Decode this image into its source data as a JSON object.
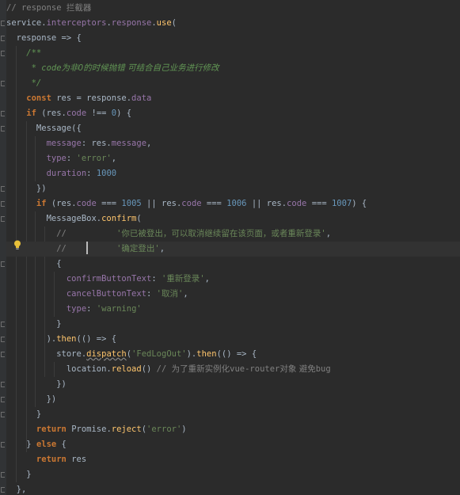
{
  "lines": [
    [
      [
        "cm-plain",
        "// response "
      ],
      [
        "cm-plain cn",
        "拦截器"
      ]
    ],
    [
      [
        "plain",
        "service."
      ],
      [
        "prop",
        "interceptors"
      ],
      [
        "plain",
        "."
      ],
      [
        "prop",
        "response"
      ],
      [
        "plain",
        "."
      ],
      [
        "fn",
        "use"
      ],
      [
        "plain",
        "("
      ]
    ],
    [
      [
        "plain",
        "  response => {"
      ]
    ],
    [
      [
        "doc",
        "    /**"
      ]
    ],
    [
      [
        "doc",
        "     * code"
      ],
      [
        "doc cn",
        "为非0的时候抛错 可结合自己业务进行修改"
      ]
    ],
    [
      [
        "doc",
        "     */"
      ]
    ],
    [
      [
        "kw",
        "    const "
      ],
      [
        "plain",
        "res = response."
      ],
      [
        "prop",
        "data"
      ]
    ],
    [
      [
        "kw",
        "    if "
      ],
      [
        "plain",
        "(res."
      ],
      [
        "prop",
        "code"
      ],
      [
        "plain",
        " !== "
      ],
      [
        "num",
        "0"
      ],
      [
        "plain",
        ") {"
      ]
    ],
    [
      [
        "plain",
        "      Message({"
      ]
    ],
    [
      [
        "prop",
        "        message"
      ],
      [
        "plain",
        ": res."
      ],
      [
        "prop",
        "message"
      ],
      [
        "plain",
        ","
      ]
    ],
    [
      [
        "prop",
        "        type"
      ],
      [
        "plain",
        ": "
      ],
      [
        "str",
        "'error'"
      ],
      [
        "plain",
        ","
      ]
    ],
    [
      [
        "prop",
        "        duration"
      ],
      [
        "plain",
        ": "
      ],
      [
        "num",
        "1000"
      ]
    ],
    [
      [
        "plain",
        "      })"
      ]
    ],
    [
      [
        "kw",
        "      if "
      ],
      [
        "plain",
        "(res."
      ],
      [
        "prop",
        "code"
      ],
      [
        "plain",
        " === "
      ],
      [
        "num",
        "1005"
      ],
      [
        "plain",
        " || res."
      ],
      [
        "prop",
        "code"
      ],
      [
        "plain",
        " === "
      ],
      [
        "num",
        "1006"
      ],
      [
        "plain",
        " || res."
      ],
      [
        "prop",
        "code"
      ],
      [
        "plain",
        " === "
      ],
      [
        "num",
        "1007"
      ],
      [
        "plain",
        ") {"
      ]
    ],
    [
      [
        "plain",
        "        MessageBox."
      ],
      [
        "fn",
        "confirm"
      ],
      [
        "plain",
        "("
      ]
    ],
    [
      [
        "cm-plain",
        "          //          "
      ],
      [
        "str",
        "'"
      ],
      [
        "str cn",
        "你已被登出，可以取消继续留在该页面，或者重新登录"
      ],
      [
        "str",
        "'"
      ],
      [
        "plain",
        ","
      ]
    ],
    [
      [
        "cm-plain",
        "          //          "
      ],
      [
        "str",
        "'"
      ],
      [
        "str cn",
        "确定登出"
      ],
      [
        "str",
        "'"
      ],
      [
        "plain",
        ","
      ]
    ],
    [
      [
        "plain",
        "          {"
      ]
    ],
    [
      [
        "prop",
        "            confirmButtonText"
      ],
      [
        "plain",
        ": "
      ],
      [
        "str",
        "'"
      ],
      [
        "str cn",
        "重新登录"
      ],
      [
        "str",
        "'"
      ],
      [
        "plain",
        ","
      ]
    ],
    [
      [
        "prop",
        "            cancelButtonText"
      ],
      [
        "plain",
        ": "
      ],
      [
        "str",
        "'"
      ],
      [
        "str cn",
        "取消"
      ],
      [
        "str",
        "'"
      ],
      [
        "plain",
        ","
      ]
    ],
    [
      [
        "prop",
        "            type"
      ],
      [
        "plain",
        ": "
      ],
      [
        "str",
        "'warning'"
      ]
    ],
    [
      [
        "plain",
        "          }"
      ]
    ],
    [
      [
        "plain",
        "        )."
      ],
      [
        "fn",
        "then"
      ],
      [
        "plain",
        "(() => {"
      ]
    ],
    [
      [
        "plain",
        "          store."
      ],
      [
        "fn squiggle",
        "dispatch"
      ],
      [
        "plain",
        "("
      ],
      [
        "str",
        "'FedLogOut'"
      ],
      [
        "plain",
        ")."
      ],
      [
        "fn",
        "then"
      ],
      [
        "plain",
        "(() => {"
      ]
    ],
    [
      [
        "plain",
        "            location."
      ],
      [
        "fn",
        "reload"
      ],
      [
        "plain",
        "() "
      ],
      [
        "cm-plain",
        "// "
      ],
      [
        "cm-plain cn",
        "为了重新实例化"
      ],
      [
        "cm-plain",
        "vue-router"
      ],
      [
        "cm-plain cn",
        "对象 避免"
      ],
      [
        "cm-plain",
        "bug"
      ]
    ],
    [
      [
        "plain",
        "          })"
      ]
    ],
    [
      [
        "plain",
        "        })"
      ]
    ],
    [
      [
        "plain",
        "      }"
      ]
    ],
    [
      [
        "kw",
        "      return "
      ],
      [
        "plain",
        "Promise."
      ],
      [
        "fn",
        "reject"
      ],
      [
        "plain",
        "("
      ],
      [
        "str",
        "'error'"
      ],
      [
        "plain",
        ")"
      ]
    ],
    [
      [
        "plain",
        "    } "
      ],
      [
        "kw",
        "else "
      ],
      [
        "plain",
        "{"
      ]
    ],
    [
      [
        "kw",
        "      return "
      ],
      [
        "plain",
        "res"
      ]
    ],
    [
      [
        "plain",
        "    }"
      ]
    ],
    [
      [
        "plain",
        "  },"
      ]
    ]
  ],
  "current_line": 16,
  "icons": {
    "intention_bulb": "lightbulb-icon",
    "fold_marker": "fold-marker-icon"
  }
}
